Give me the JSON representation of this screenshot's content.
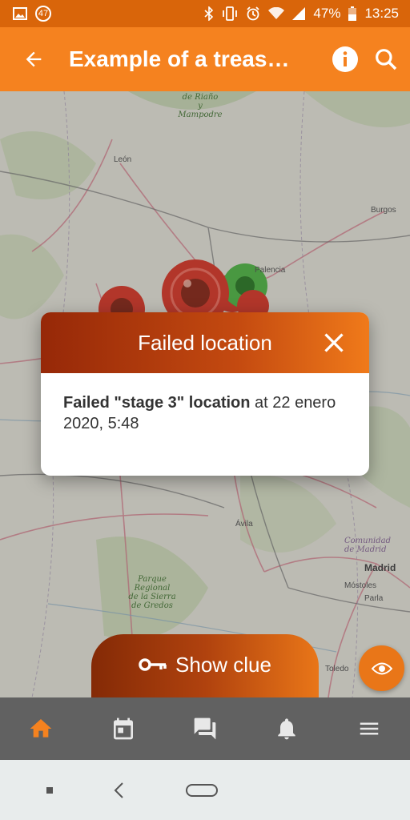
{
  "status_bar": {
    "notification_count": "47",
    "battery": "47%",
    "time": "13:25",
    "icons": [
      "image-icon",
      "bluetooth-icon",
      "vibrate-icon",
      "alarm-icon",
      "wifi-icon",
      "signal-icon",
      "battery-icon"
    ]
  },
  "app_bar": {
    "title": "Example of a treas…",
    "back_icon": "arrow-left-icon",
    "info_icon": "info-icon",
    "search_icon": "search-icon"
  },
  "map": {
    "labels": [
      {
        "text": "de Riaño\ny Mampodre",
        "kind": "park"
      },
      {
        "text": "León",
        "kind": "city"
      },
      {
        "text": "Burgos",
        "kind": "city"
      },
      {
        "text": "Palencia",
        "kind": "city"
      },
      {
        "text": "Ávila",
        "kind": "city"
      },
      {
        "text": "Parque\nRegional\nde la Sierra\nde Gredos",
        "kind": "park"
      },
      {
        "text": "Comunidad\nde Madrid",
        "kind": "region"
      },
      {
        "text": "Madrid",
        "kind": "city"
      },
      {
        "text": "Móstoles",
        "kind": "city"
      },
      {
        "text": "Parla",
        "kind": "city"
      },
      {
        "text": "Toledo",
        "kind": "city"
      }
    ]
  },
  "dialog": {
    "title": "Failed location",
    "close_icon": "close-icon",
    "message_bold": "Failed \"stage 3\" location",
    "message_rest": " at 22 enero 2020, 5:48"
  },
  "clue_button": {
    "label": "Show clue",
    "icon": "key-icon"
  },
  "eye_button": {
    "icon": "eye-icon"
  },
  "bottom_nav": {
    "items": [
      {
        "icon": "home-icon",
        "active": true
      },
      {
        "icon": "calendar-icon",
        "active": false
      },
      {
        "icon": "chat-icon",
        "active": false
      },
      {
        "icon": "bell-icon",
        "active": false
      },
      {
        "icon": "menu-icon",
        "active": false
      }
    ]
  },
  "colors": {
    "app_bar": "#f5821f",
    "status_bar": "#d9650a",
    "bottom_nav": "#616161",
    "active_nav": "#f5821f",
    "failed_marker": "#d93a2b",
    "success_marker": "#52b848"
  }
}
